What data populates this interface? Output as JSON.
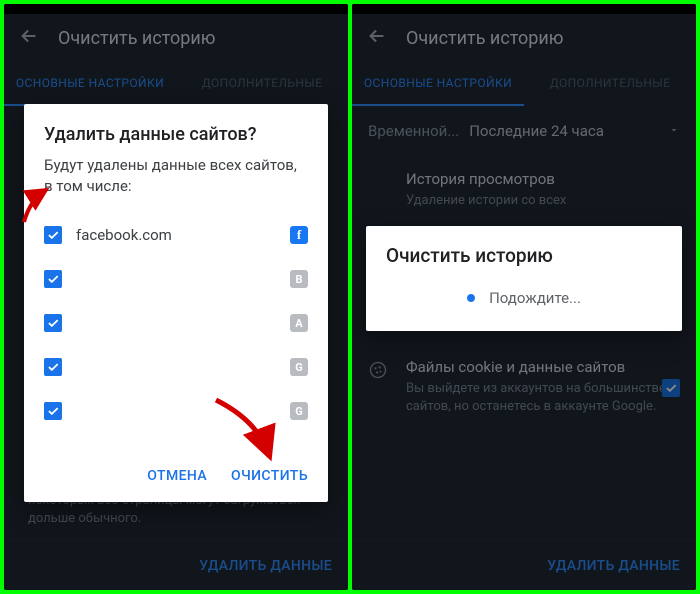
{
  "left": {
    "toolbar_title": "Очистить историю",
    "tabs": {
      "basic": "ОСНОВНЫЕ НАСТРОЙКИ",
      "advanced": "ДОПОЛНИТЕЛЬНЫЕ"
    },
    "below_dialog_hint": "некоторых веб-страницы могут загружаться дольше обычного.",
    "clear_button": "УДАЛИТЬ ДАННЫЕ",
    "dialog": {
      "title": "Удалить данные сайтов?",
      "subtitle": "Будут удалены данные всех сайтов, в том числе:",
      "sites": [
        {
          "name": "facebook.com",
          "fav": "f",
          "favClass": "fb"
        },
        {
          "name": "",
          "fav": "B",
          "favClass": "gray"
        },
        {
          "name": "",
          "fav": "A",
          "favClass": "gray"
        },
        {
          "name": "",
          "fav": "G",
          "favClass": "gray"
        },
        {
          "name": "",
          "fav": "G",
          "favClass": "gray"
        }
      ],
      "cancel": "ОТМЕНА",
      "confirm": "ОЧИСТИТЬ"
    }
  },
  "right": {
    "toolbar_title": "Очистить историю",
    "tabs": {
      "basic": "ОСНОВНЫЕ НАСТРОЙКИ",
      "advanced": "ДОПОЛНИТЕЛЬНЫЕ"
    },
    "timerange_label": "Временной...",
    "timerange_value": "Последние 24 часа",
    "history_title": "История просмотров",
    "history_sub": "Удаление истории со всех",
    "cookies_title": "Файлы cookie и данные сайтов",
    "cookies_sub": "Вы выйдете из аккаунтов на большинстве сайтов, но останетесь в аккаунте Google.",
    "clear_button": "УДАЛИТЬ ДАННЫЕ",
    "dialog": {
      "title": "Очистить историю",
      "wait": "Подождите..."
    }
  }
}
